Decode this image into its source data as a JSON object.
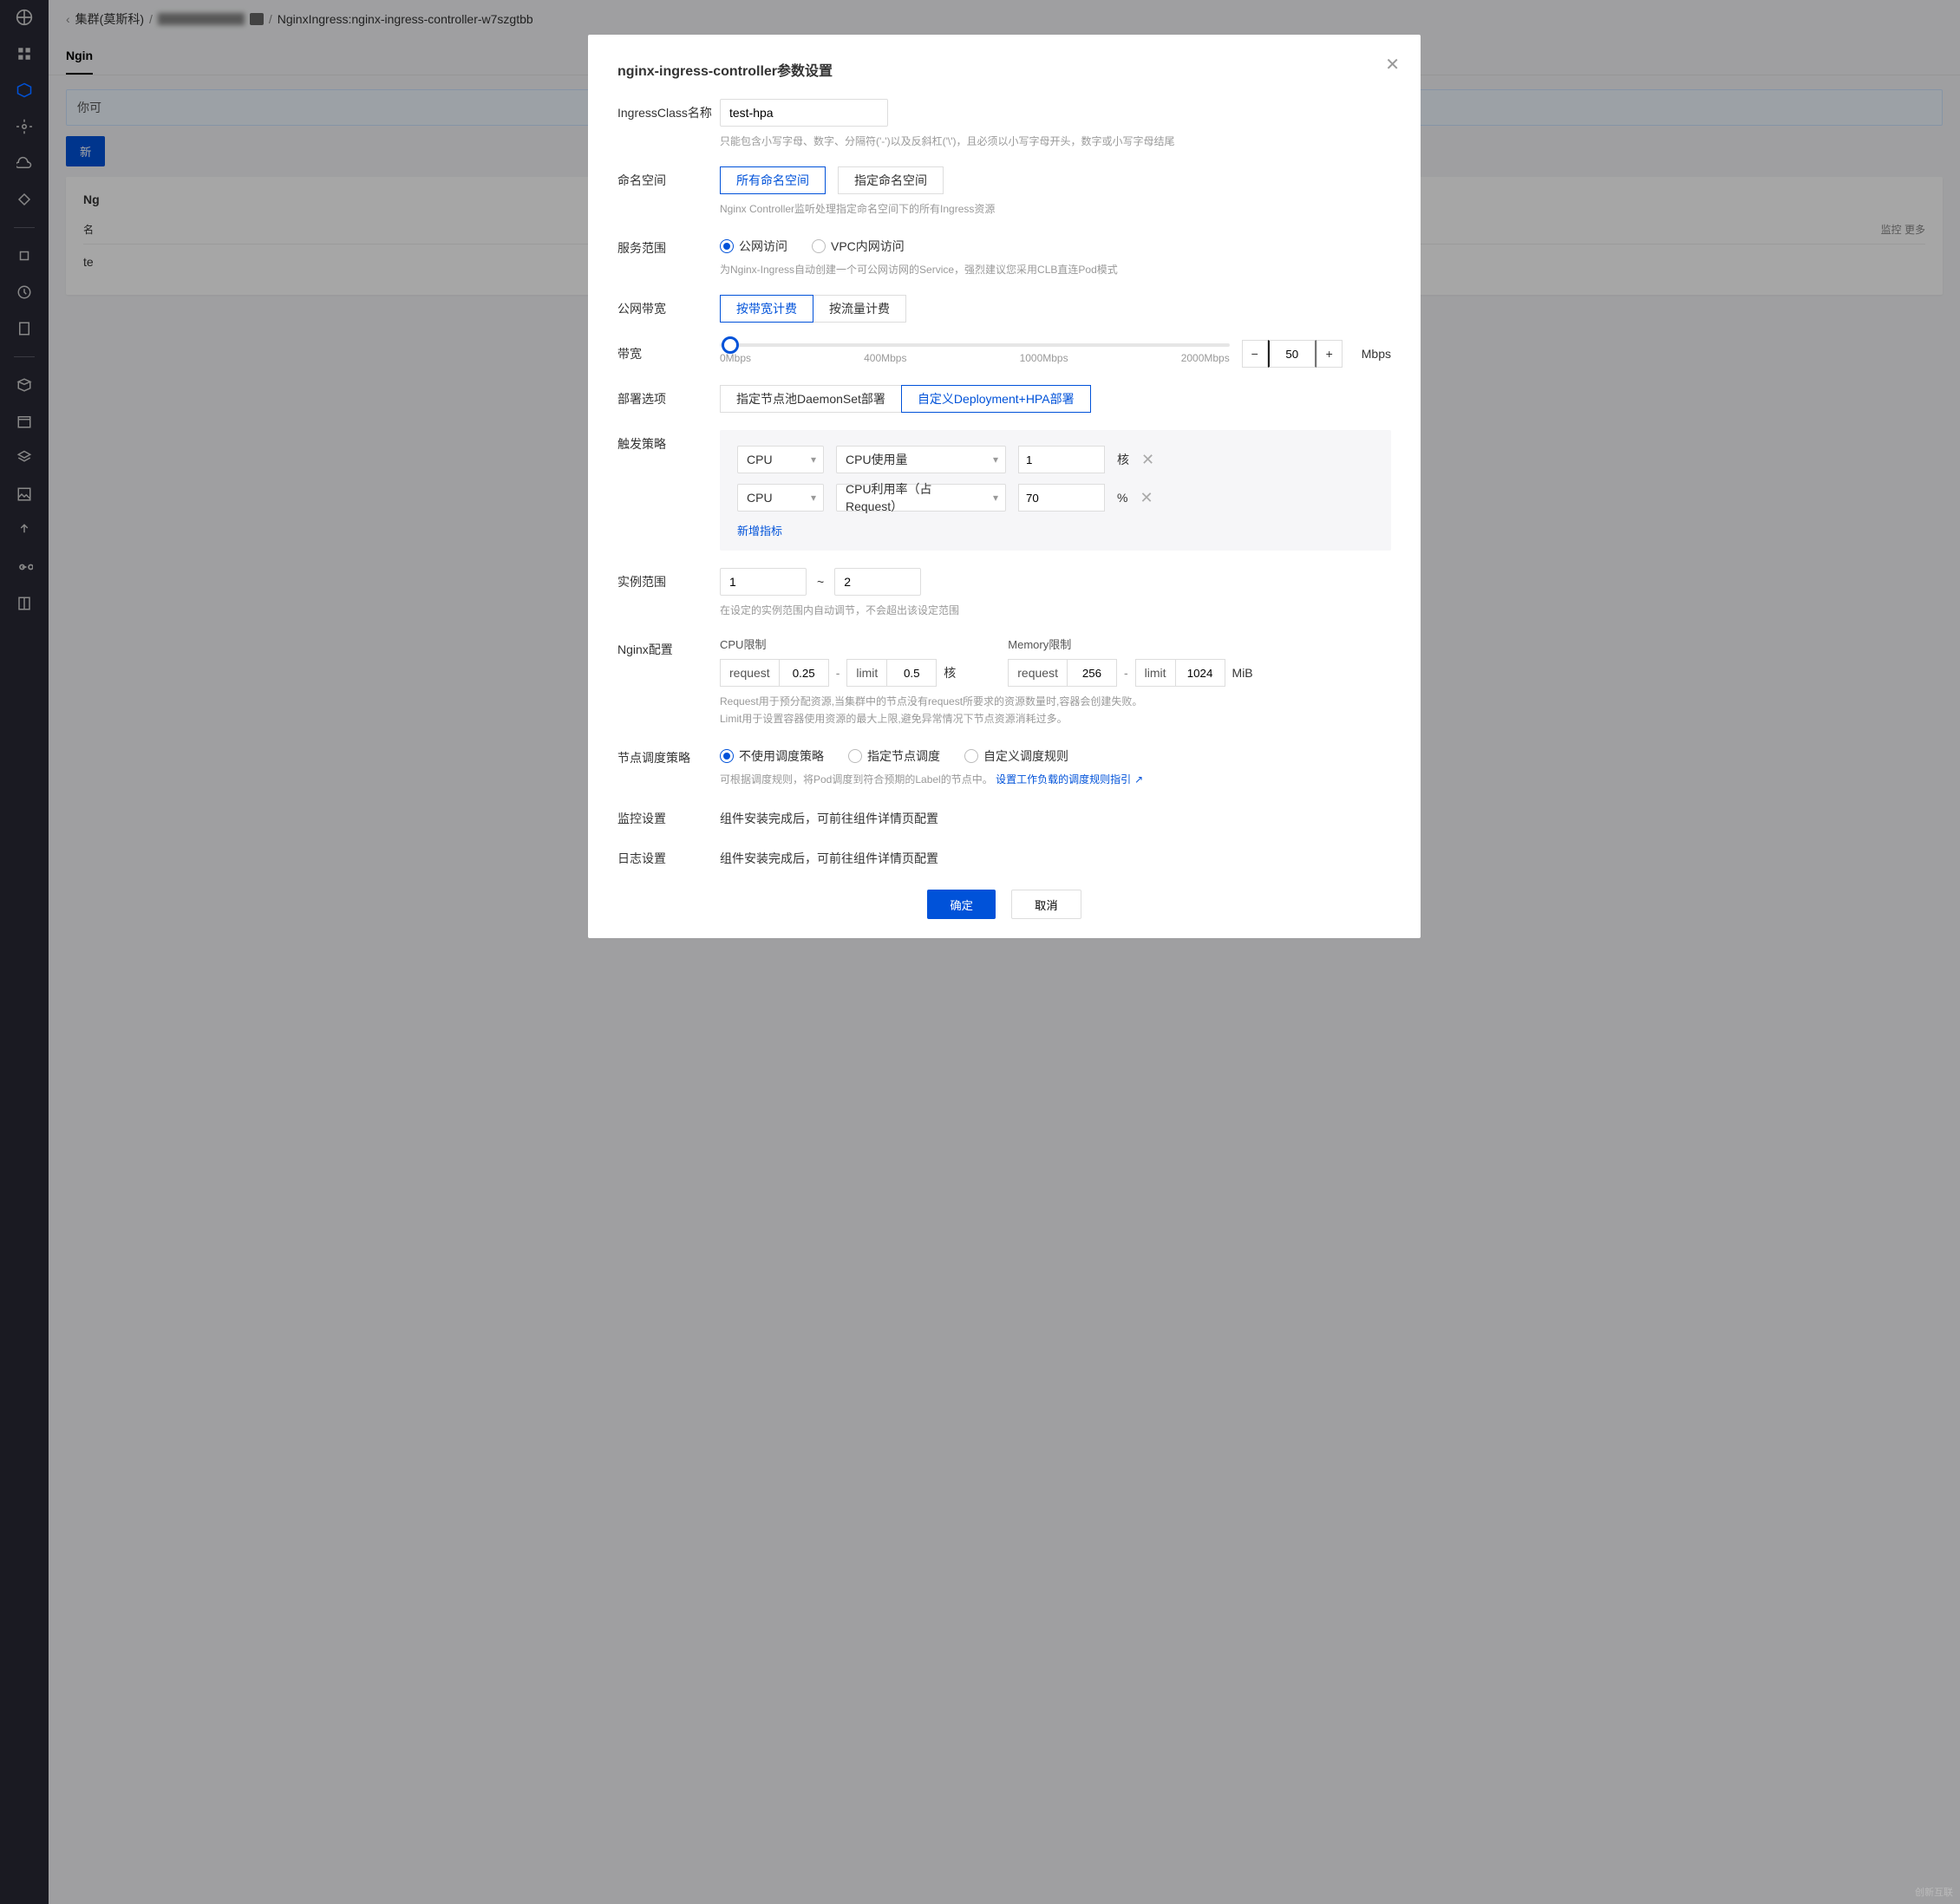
{
  "breadcrumb": {
    "back": "‹",
    "cluster": "集群(莫斯科)",
    "resource": "NginxIngress:nginx-ingress-controller-w7szgtbb"
  },
  "page_tabs": {
    "main": "Ngin"
  },
  "alert_text": "你可",
  "new_button": "新",
  "card_title": "Ng",
  "col_name": "名",
  "row1_name": "te",
  "more_links": "监控  更多",
  "modal": {
    "title": "nginx-ingress-controller参数设置",
    "ingress_class": {
      "label": "IngressClass名称",
      "value": "test-hpa",
      "help": "只能包含小写字母、数字、分隔符('-')以及反斜杠('\\')，且必须以小写字母开头，数字或小写字母结尾"
    },
    "namespace": {
      "label": "命名空间",
      "option_all": "所有命名空间",
      "option_specific": "指定命名空间",
      "help": "Nginx Controller监听处理指定命名空间下的所有Ingress资源"
    },
    "scope": {
      "label": "服务范围",
      "option_public": "公网访问",
      "option_vpc": "VPC内网访问",
      "help": "为Nginx-Ingress自动创建一个可公网访网的Service，强烈建议您采用CLB直连Pod模式"
    },
    "billing": {
      "label": "公网带宽",
      "option_bandwidth": "按带宽计费",
      "option_traffic": "按流量计费"
    },
    "bandwidth": {
      "label": "带宽",
      "min": "0Mbps",
      "m1": "400Mbps",
      "m2": "1000Mbps",
      "max": "2000Mbps",
      "value": "50",
      "unit": "Mbps"
    },
    "deploy": {
      "label": "部署选项",
      "option_daemonset": "指定节点池DaemonSet部署",
      "option_hpa": "自定义Deployment+HPA部署"
    },
    "trigger": {
      "label": "触发策略",
      "rows": [
        {
          "metric": "CPU",
          "type": "CPU使用量",
          "value": "1",
          "unit": "核"
        },
        {
          "metric": "CPU",
          "type": "CPU利用率（占Request）",
          "value": "70",
          "unit": "%"
        }
      ],
      "add": "新增指标"
    },
    "instance_range": {
      "label": "实例范围",
      "min": "1",
      "sep": "~",
      "max": "2",
      "help": "在设定的实例范围内自动调节，不会超出该设定范围"
    },
    "nginx_conf": {
      "label": "Nginx配置",
      "cpu_title": "CPU限制",
      "mem_title": "Memory限制",
      "request_label": "request",
      "limit_label": "limit",
      "cpu_request": "0.25",
      "cpu_limit": "0.5",
      "cpu_unit": "核",
      "mem_request": "256",
      "mem_limit": "1024",
      "mem_unit": "MiB",
      "sep": "-",
      "help1": "Request用于预分配资源,当集群中的节点没有request所要求的资源数量时,容器会创建失败。",
      "help2": "Limit用于设置容器使用资源的最大上限,避免异常情况下节点资源消耗过多。"
    },
    "scheduling": {
      "label": "节点调度策略",
      "opt_none": "不使用调度策略",
      "opt_node": "指定节点调度",
      "opt_custom": "自定义调度规则",
      "help_pre": "可根据调度规则，将Pod调度到符合预期的Label的节点中。",
      "link": "设置工作负载的调度规则指引"
    },
    "monitor": {
      "label": "监控设置",
      "text": "组件安装完成后，可前往组件详情页配置"
    },
    "log": {
      "label": "日志设置",
      "text": "组件安装完成后，可前往组件详情页配置"
    },
    "footer": {
      "ok": "确定",
      "cancel": "取消"
    }
  },
  "watermark": "创新互联"
}
